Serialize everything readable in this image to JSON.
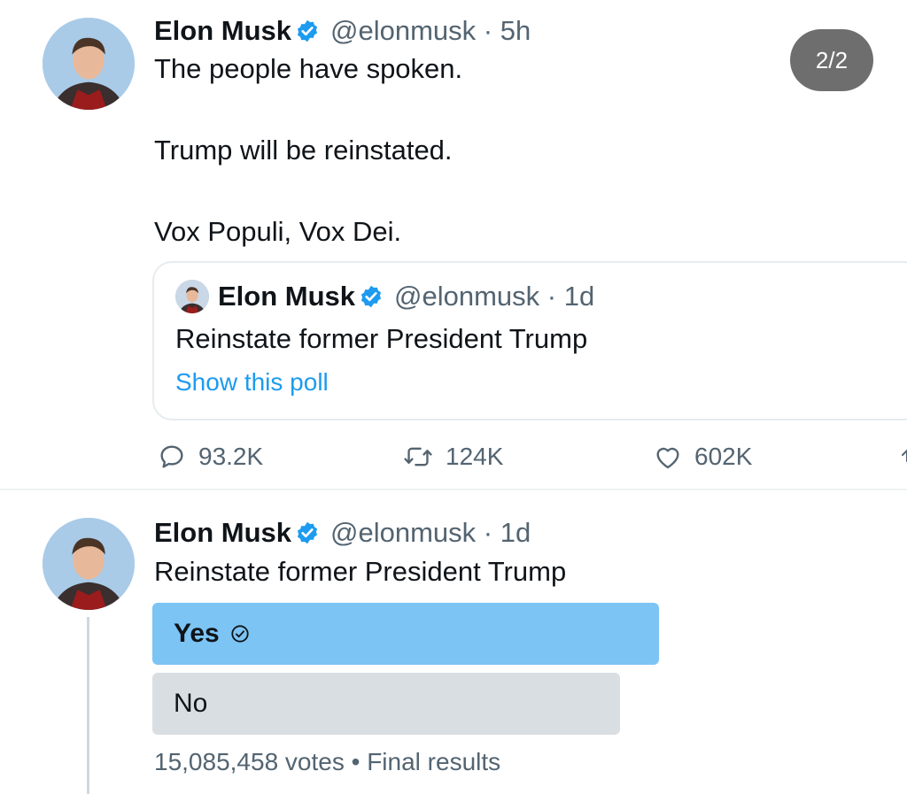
{
  "tweet": {
    "author_name": "Elon Musk",
    "handle_time": "@elonmusk · 5h",
    "line1": "The people have spoken.",
    "line2": "Trump will be reinstated.",
    "line3": "Vox Populi, Vox Dei.",
    "image_counter": "2/2",
    "quote": {
      "author_name": "Elon Musk",
      "handle_time": "@elonmusk · 1d",
      "text": "Reinstate former President Trump",
      "link": "Show this poll"
    },
    "actions": {
      "replies": "93.2K",
      "retweets": "124K",
      "likes": "602K"
    }
  },
  "poll_tweet": {
    "author_name": "Elon Musk",
    "handle_time": "@elonmusk · 1d",
    "text": "Reinstate former President Trump",
    "options": [
      {
        "label": "Yes",
        "winner": true
      },
      {
        "label": "No",
        "winner": false
      }
    ],
    "footer": "15,085,458 votes • Final results"
  },
  "colors": {
    "accent": "#1d9bf0",
    "poll_winner": "#7cc4f4",
    "poll_other": "#d9dee2",
    "secondary_text": "#536471"
  },
  "icons": [
    "verified-badge-icon",
    "reply-icon",
    "retweet-icon",
    "like-icon",
    "check-circle-icon",
    "share-icon"
  ]
}
